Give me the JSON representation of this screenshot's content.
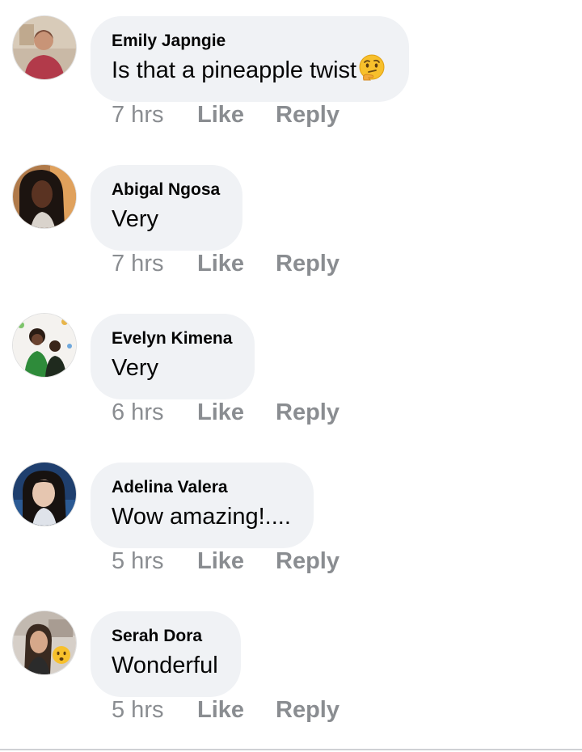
{
  "comments": [
    {
      "author": "Emily Japngie",
      "text": "Is that a pineapple twist",
      "emoji": "thinking-face-icon",
      "time": "7 hrs",
      "like": "Like",
      "reply": "Reply"
    },
    {
      "author": "Abigal Ngosa",
      "text": "Very",
      "time": "7 hrs",
      "like": "Like",
      "reply": "Reply"
    },
    {
      "author": "Evelyn Kimena",
      "text": "Very",
      "time": "6 hrs",
      "like": "Like",
      "reply": "Reply"
    },
    {
      "author": "Adelina Valera",
      "text": "Wow amazing!....",
      "time": "5 hrs",
      "like": "Like",
      "reply": "Reply"
    },
    {
      "author": "Serah Dora",
      "text": "Wonderful",
      "time": "5 hrs",
      "like": "Like",
      "reply": "Reply"
    }
  ],
  "colors": {
    "bubble": "#f0f2f5",
    "meta_text": "#8a8d91",
    "primary_text": "#050505"
  }
}
